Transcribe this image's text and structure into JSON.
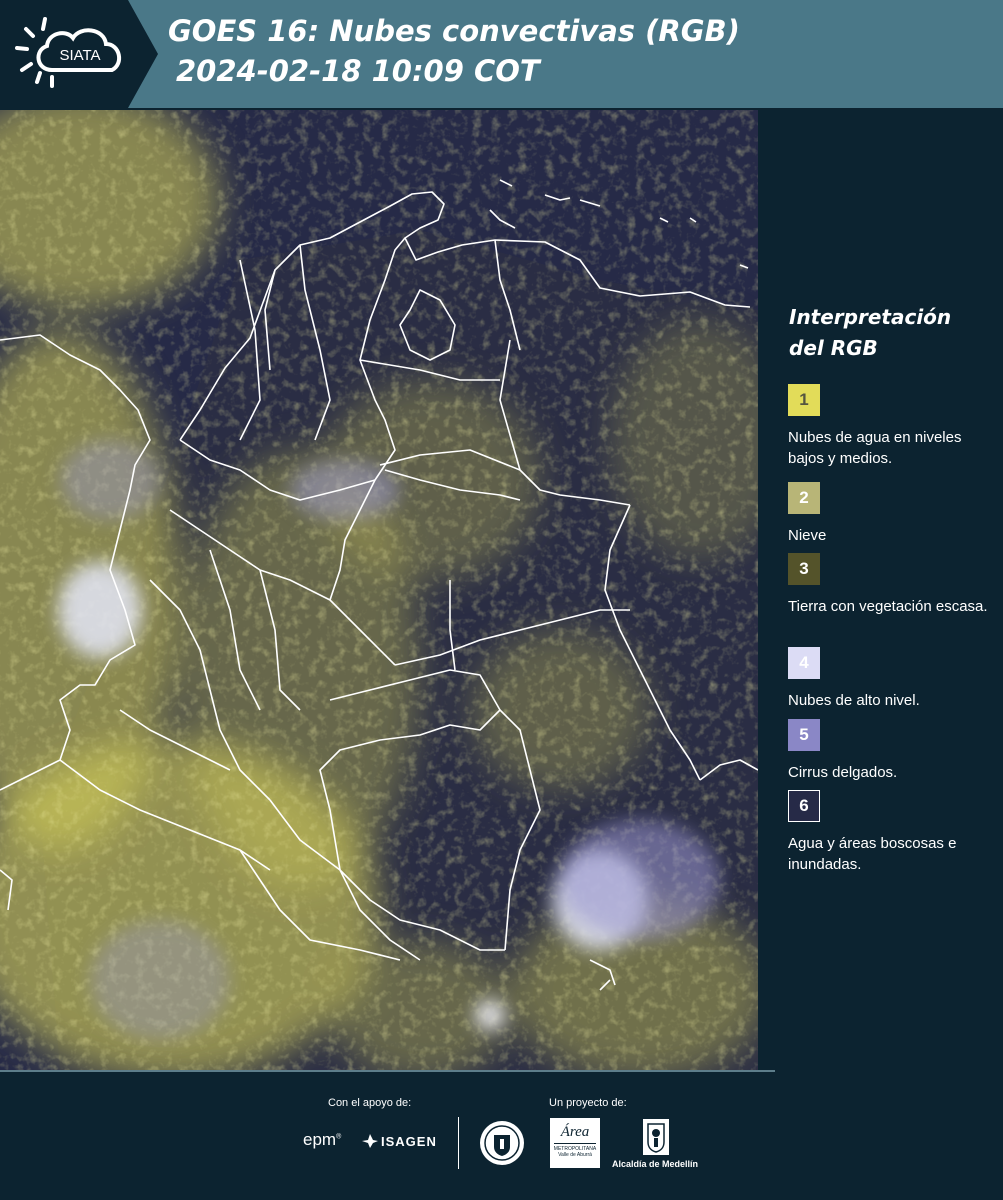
{
  "header": {
    "title_line1": "GOES 16: Nubes convectivas (RGB)",
    "title_line2": "2024-02-18 10:09 COT",
    "logo_text": "SIATA"
  },
  "legend": {
    "title_line1": "Interpretación",
    "title_line2": "del RGB",
    "items": [
      {
        "number": "1",
        "label": "Nubes de agua en niveles bajos y medios.",
        "color": "#e2dc59",
        "text_color": "#555540"
      },
      {
        "number": "2",
        "label": "Nieve",
        "color": "#b8b577",
        "text_color": "#ffffff"
      },
      {
        "number": "3",
        "label": "Tierra con vegetación escasa.",
        "color": "#54532a",
        "text_color": "#ffffff"
      },
      {
        "number": "4",
        "label": "Nubes de alto nivel.",
        "color": "#dcdcf5",
        "text_color": "#ffffff"
      },
      {
        "number": "5",
        "label": "Cirrus delgados.",
        "color": "#8a87c6",
        "text_color": "#ffffff"
      },
      {
        "number": "6",
        "label": "Agua y áreas boscosas e inundadas.",
        "color": "#262a47",
        "text_color": "#ffffff"
      }
    ]
  },
  "footer": {
    "support_label": "Con el apoyo de:",
    "project_label": "Un proyecto de:",
    "sponsor_epm": "epm",
    "sponsor_isagen": "ISAGEN",
    "partner_area_line1": "Área",
    "partner_area_line2": "METROPOLITANA",
    "partner_area_line3": "Valle de Aburrá",
    "partner_alcaldia": "Alcaldía de Medellín"
  },
  "colors": {
    "header_bg": "#4a7888",
    "page_bg": "#0c2330",
    "map_dark": "#262a47",
    "cloud_yellow": "#d9d45a",
    "cloud_white": "#e4e6f7",
    "border_white": "#ffffff"
  }
}
